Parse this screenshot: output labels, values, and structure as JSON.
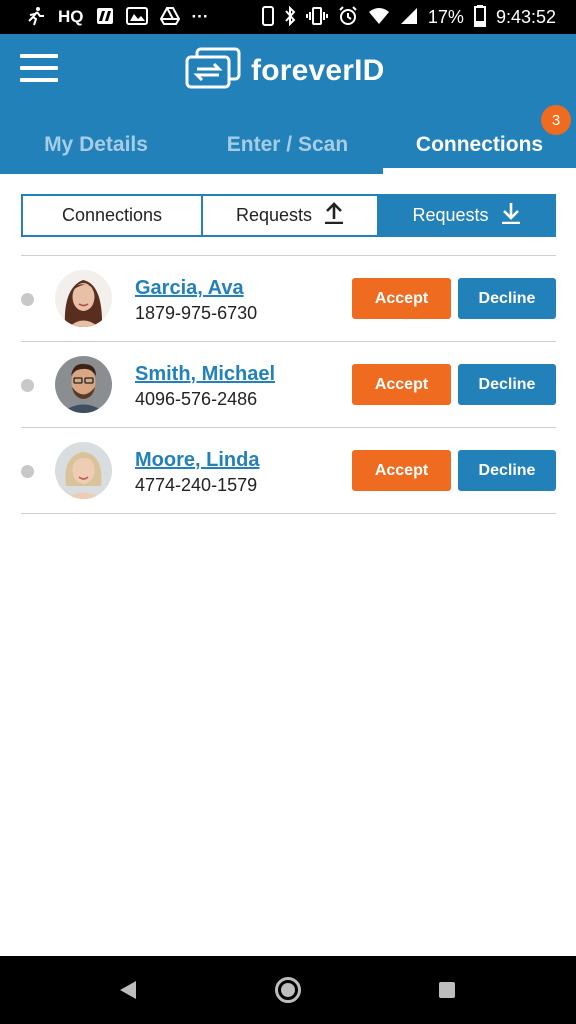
{
  "status_bar": {
    "left_icons": [
      "running-person-icon",
      "hq-icon",
      "hangouts-icon",
      "gallery-icon",
      "drive-icon",
      "more-dots-icon"
    ],
    "hq_text": "HQ",
    "more_text": "···",
    "battery_percent": "17%",
    "time": "9:43:52"
  },
  "app_bar": {
    "logo_text": "foreverID",
    "tabs": [
      {
        "label": "My Details",
        "active": false
      },
      {
        "label": "Enter / Scan",
        "active": false
      },
      {
        "label": "Connections",
        "active": true
      }
    ],
    "badge_count": "3"
  },
  "segments": [
    {
      "label": "Connections",
      "icon": "",
      "active": false
    },
    {
      "label": "Requests",
      "icon": "upload-arrow-icon",
      "active": false
    },
    {
      "label": "Requests",
      "icon": "download-arrow-icon",
      "active": true
    }
  ],
  "requests": [
    {
      "name": "Garcia, Ava",
      "phone": "1879-975-6730",
      "accept_label": "Accept",
      "decline_label": "Decline"
    },
    {
      "name": "Smith, Michael",
      "phone": "4096-576-2486",
      "accept_label": "Accept",
      "decline_label": "Decline"
    },
    {
      "name": "Moore, Linda",
      "phone": "4774-240-1579",
      "accept_label": "Accept",
      "decline_label": "Decline"
    }
  ],
  "colors": {
    "brand_blue": "#2381b9",
    "accent_orange": "#ee6b1f",
    "inactive_tab": "#a6cde6"
  }
}
